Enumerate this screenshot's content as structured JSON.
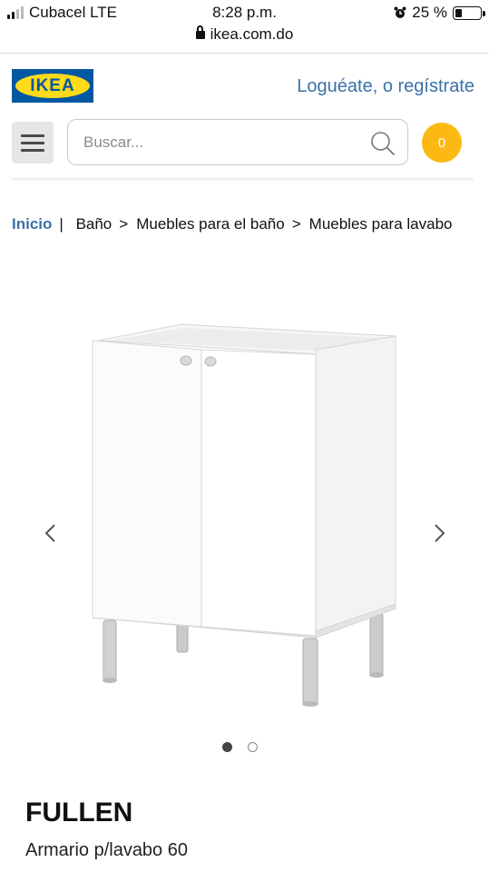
{
  "status_bar": {
    "carrier": "Cubacel LTE",
    "time": "8:28 p.m.",
    "battery": "25 %",
    "battery_level": 0.25
  },
  "browser": {
    "url": "ikea.com.do"
  },
  "header": {
    "logo_text": "IKEA",
    "login_link": "Loguéate, o regístrate",
    "search_placeholder": "Buscar...",
    "cart_count": "0"
  },
  "breadcrumb": {
    "home": "Inicio",
    "items": [
      "Baño",
      "Muebles para el baño",
      "Muebles para lavabo"
    ]
  },
  "product": {
    "name": "FULLEN",
    "description": "Armario p/lavabo 60",
    "image_count": 2,
    "active_image": 1
  },
  "colors": {
    "ikea_blue": "#0058a3",
    "ikea_yellow": "#ffda1a",
    "cart_badge": "#fdb913",
    "link": "#3a72a8"
  }
}
